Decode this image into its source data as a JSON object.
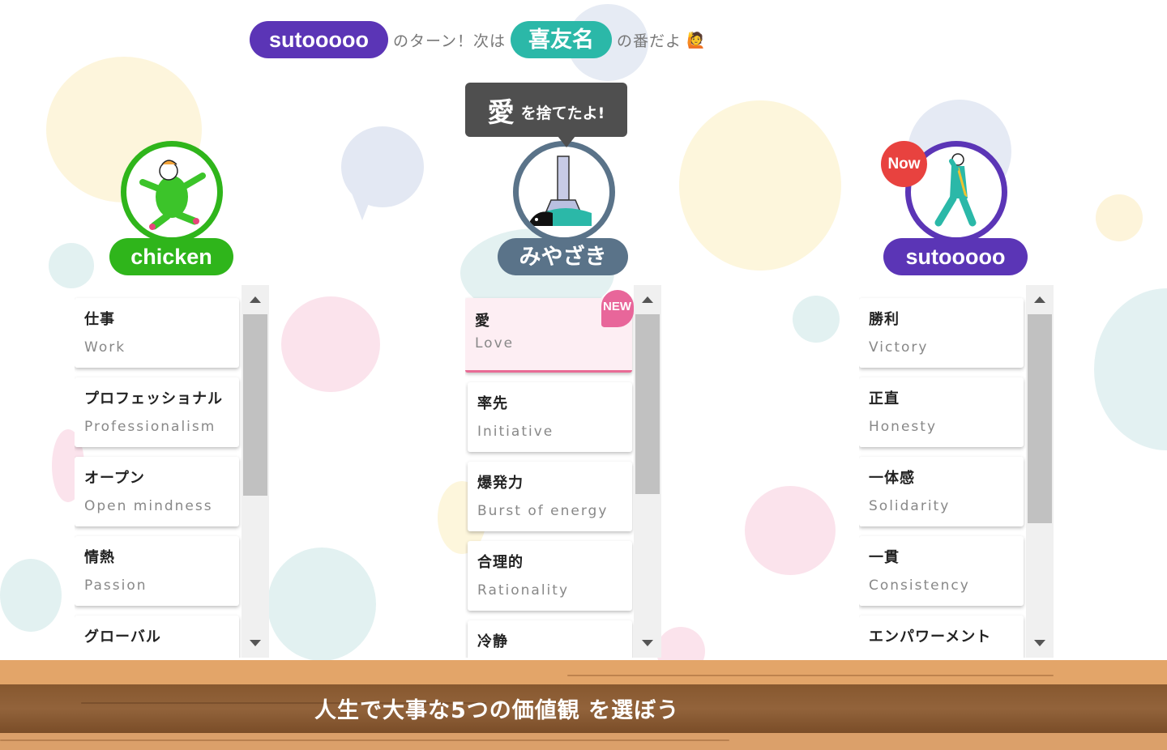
{
  "banner": {
    "current_player": "sutooooo",
    "turn_text": "のターン！次は",
    "next_player": "喜友名",
    "next_text": "の番だよ",
    "emoji": "🙋"
  },
  "players": [
    {
      "name": "chicken",
      "color": "#2fb51b"
    },
    {
      "name": "みやざき",
      "color": "#5a7389"
    },
    {
      "name": "sutooooo",
      "color": "#5b35b6"
    }
  ],
  "now_badge": "Now",
  "discard_tooltip": {
    "word": "愛",
    "text": "を捨てたよ!"
  },
  "new_badge": "NEW",
  "lists": {
    "chicken": [
      {
        "jp": "仕事",
        "en": "Work"
      },
      {
        "jp": "プロフェッショナル",
        "en": "Professionalism"
      },
      {
        "jp": "オープン",
        "en": "Open mindness"
      },
      {
        "jp": "情熱",
        "en": "Passion"
      },
      {
        "jp": "グローバル",
        "en": ""
      }
    ],
    "miyazaki": [
      {
        "jp": "愛",
        "en": "Love"
      },
      {
        "jp": "率先",
        "en": "Initiative"
      },
      {
        "jp": "爆発力",
        "en": "Burst of energy"
      },
      {
        "jp": "合理的",
        "en": "Rationality"
      },
      {
        "jp": "冷静",
        "en": ""
      }
    ],
    "sutooooo": [
      {
        "jp": "勝利",
        "en": "Victory"
      },
      {
        "jp": "正直",
        "en": "Honesty"
      },
      {
        "jp": "一体感",
        "en": "Solidarity"
      },
      {
        "jp": "一貫",
        "en": "Consistency"
      },
      {
        "jp": "エンパワーメント",
        "en": ""
      }
    ]
  },
  "instruction": "人生で大事な5つの価値観 を選ぼう"
}
